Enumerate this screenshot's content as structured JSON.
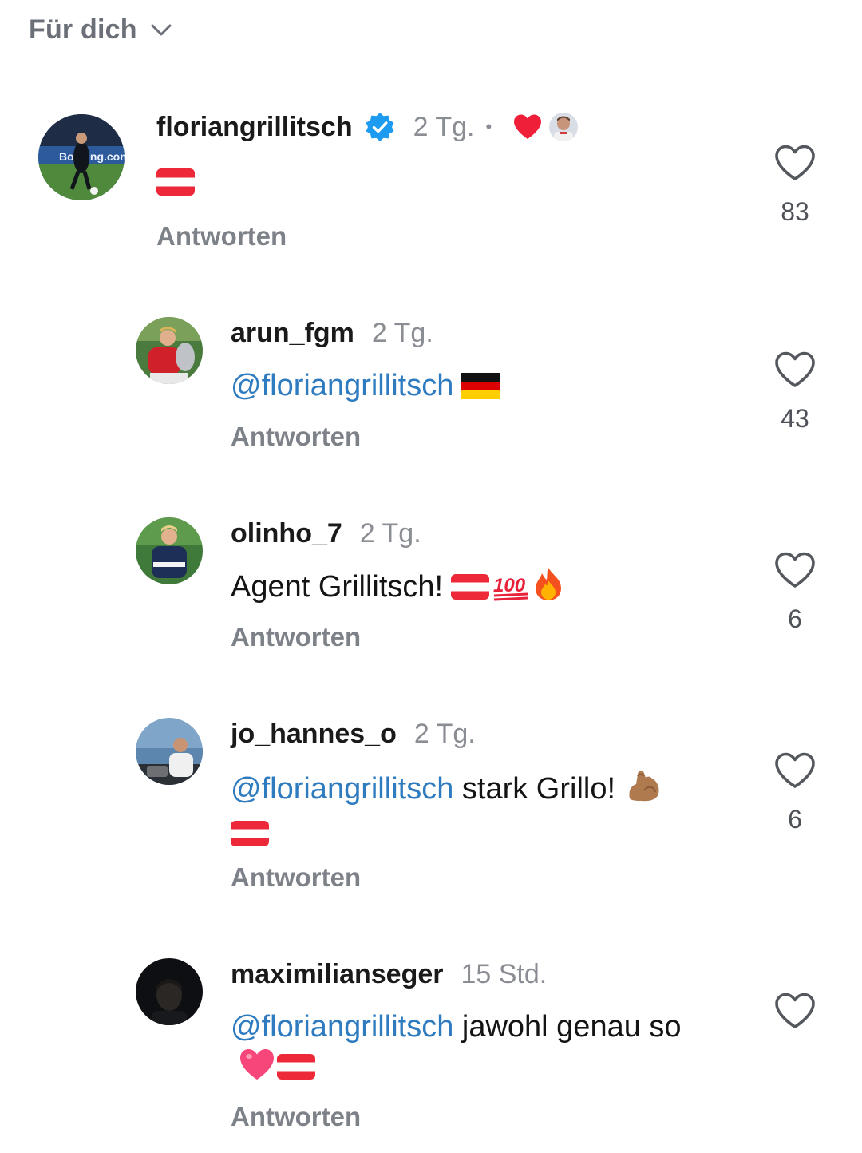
{
  "header": {
    "label": "Für dich",
    "icon": "chevron-down-icon"
  },
  "comments": [
    {
      "username": "floriangrillitsch",
      "verified": true,
      "time": "2 Tg.",
      "separator": "•",
      "creator_liked": true,
      "mention": "",
      "text": "",
      "emojis": [
        "flag-austria"
      ],
      "reply_label": "Antworten",
      "like_count": "83"
    },
    {
      "username": "arun_fgm",
      "time": "2 Tg.",
      "mention": "@floriangrillitsch",
      "text": "",
      "emojis": [
        "flag-germany"
      ],
      "reply_label": "Antworten",
      "like_count": "43"
    },
    {
      "username": "olinho_7",
      "time": "2 Tg.",
      "mention": "",
      "text": "Agent Grillitsch!",
      "emojis": [
        "flag-austria",
        "hundred-points",
        "fire"
      ],
      "reply_label": "Antworten",
      "like_count": "6"
    },
    {
      "username": "jo_hannes_o",
      "time": "2 Tg.",
      "mention": "@floriangrillitsch",
      "text": " stark Grillo!",
      "emojis": [
        "flexed-biceps",
        "flag-austria"
      ],
      "reply_label": "Antworten",
      "like_count": "6"
    },
    {
      "username": "maximilianseger",
      "time": "15 Std.",
      "mention": "@floriangrillitsch",
      "text": " jawohl genau so",
      "emojis": [
        "pink-heart",
        "flag-austria"
      ],
      "reply_label": "Antworten",
      "like_count": ""
    }
  ],
  "colors": {
    "mention": "#2f7bbf",
    "verified": "#1d9bf0",
    "heart_red": "#ef1f3a",
    "muted": "#8a8d93"
  }
}
